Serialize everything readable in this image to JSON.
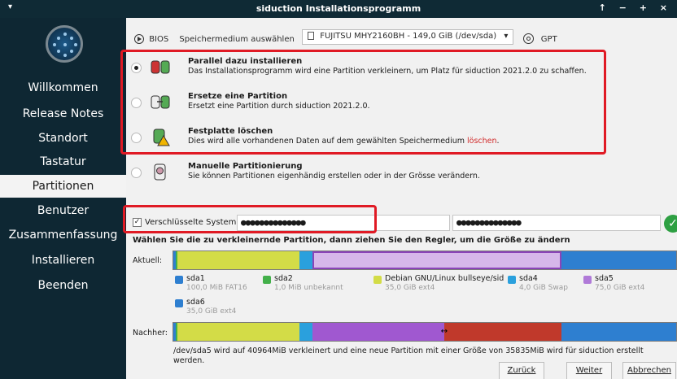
{
  "window": {
    "title": "siduction Installationsprogramm",
    "menu_icon": "▾",
    "controls": "↑ − + ×"
  },
  "sidebar": {
    "items": [
      {
        "label": "Willkommen",
        "active": false
      },
      {
        "label": "Release Notes",
        "active": false
      },
      {
        "label": "Standort",
        "active": false
      },
      {
        "label": "Tastatur",
        "active": false
      },
      {
        "label": "Partitionen",
        "active": true
      },
      {
        "label": "Benutzer",
        "active": false
      },
      {
        "label": "Zusammenfassung",
        "active": false
      },
      {
        "label": "Installieren",
        "active": false
      },
      {
        "label": "Beenden",
        "active": false
      }
    ]
  },
  "toolbar": {
    "firmware": "BIOS",
    "storage_label": "Speichermedium auswählen",
    "storage_value": "FUJITSU MHY2160BH - 149,0 GiB (/dev/sda)",
    "table_type": "GPT"
  },
  "options": [
    {
      "title": "Parallel dazu installieren",
      "desc": "Das Installationsprogramm wird eine Partition verkleinern, um Platz für siduction 2021.2.0 zu schaffen.",
      "checked": true
    },
    {
      "title": "Ersetze eine Partition",
      "desc": "Ersetzt eine Partition durch siduction 2021.2.0.",
      "checked": false
    },
    {
      "title": "Festplatte löschen",
      "desc": "Dies wird alle vorhandenen Daten auf dem gewählten Speichermedium ",
      "desc_red": "löschen",
      "desc_end": ".",
      "checked": false
    },
    {
      "title": "Manuelle Partitionierung",
      "desc": "Sie können Partitionen eigenhändig erstellen oder in der Grösse verändern.",
      "checked": false
    }
  ],
  "encryption": {
    "label": "Verschlüsselte System",
    "checked": true,
    "password1": "●●●●●●●●●●●●●●",
    "password2": "●●●●●●●●●●●●●●"
  },
  "instruction": "Wählen Sie die zu verkleinernde Partition, dann ziehen Sie den Regler, um die Größe zu ändern",
  "current_label": "Aktuell:",
  "after_label": "Nachher:",
  "partitions": [
    {
      "name": "sda1",
      "detail": "100,0 MiB FAT16",
      "color": "#2e7fd0"
    },
    {
      "name": "sda2",
      "detail": "1,0 MiB unbekannt",
      "color": "#43b04a"
    },
    {
      "name": "Debian GNU/Linux bullseye/sid",
      "detail": "35,0 GiB ext4",
      "color": "#d3dc47"
    },
    {
      "name": "sda4",
      "detail": "4,0 GiB Swap",
      "color": "#2aa0dd"
    },
    {
      "name": "sda5",
      "detail": "75,0 GiB ext4",
      "color": "#b07ad8"
    },
    {
      "name": "sda6",
      "detail": "35,0 GiB ext4",
      "color": "#2e7fd0"
    }
  ],
  "note": "/dev/sda5 wird auf 40964MiB verkleinert und eine neue Partition mit einer Größe von 35835MiB wird für siduction erstellt werden.",
  "buttons": {
    "back": "Zurück",
    "next": "Weiter",
    "cancel": "Abbrechen"
  },
  "colors": {
    "accent_red": "#e01a24",
    "new_partition": "#c0392b",
    "sidebar_bg": "#0e2733"
  }
}
